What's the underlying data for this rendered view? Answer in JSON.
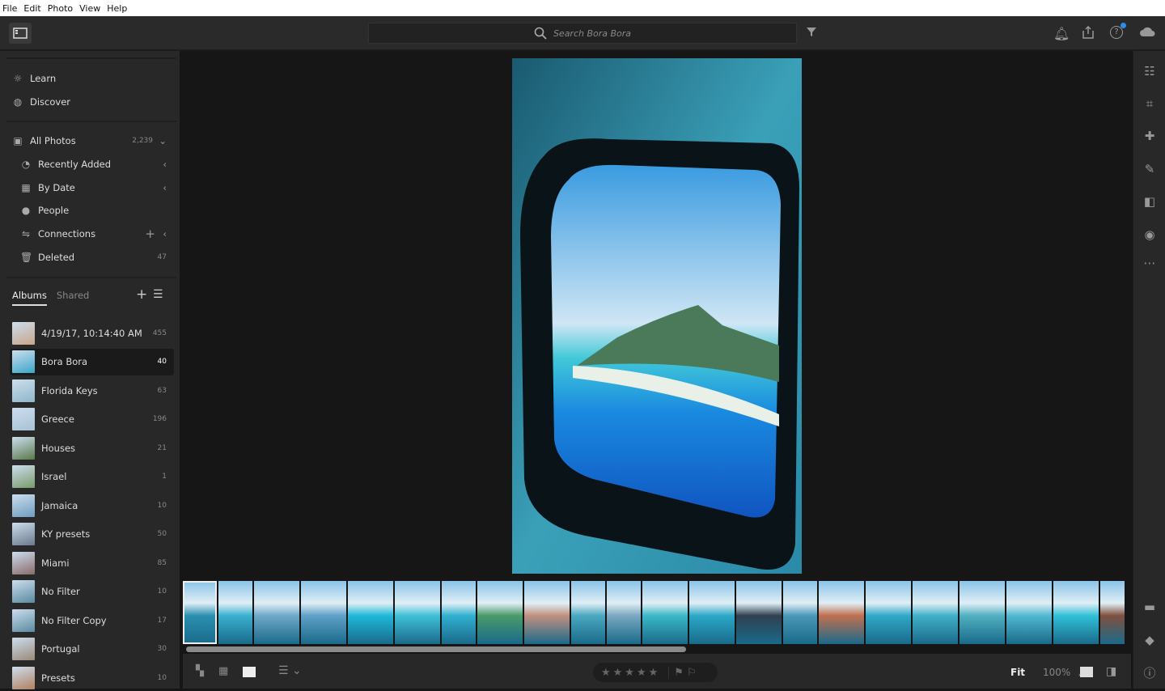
{
  "menu": [
    "File",
    "Edit",
    "Photo",
    "View",
    "Help"
  ],
  "search": {
    "placeholder": "Search Bora Bora"
  },
  "nav": {
    "learn": "Learn",
    "discover": "Discover",
    "all_photos": {
      "label": "All Photos",
      "count": "2,239"
    },
    "recently_added": "Recently Added",
    "by_date": "By Date",
    "people": "People",
    "connections": "Connections",
    "deleted": {
      "label": "Deleted",
      "count": "47"
    }
  },
  "album_tabs": {
    "albums": "Albums",
    "shared": "Shared"
  },
  "albums": [
    {
      "name": "4/19/17, 10:14:40 AM",
      "count": "455",
      "color": "#c9a58a"
    },
    {
      "name": "Bora Bora",
      "count": "40",
      "color": "#3aa6c9",
      "selected": true
    },
    {
      "name": "Florida Keys",
      "count": "63",
      "color": "#8fb7c9"
    },
    {
      "name": "Greece",
      "count": "196",
      "color": "#a8c2d6"
    },
    {
      "name": "Houses",
      "count": "21",
      "color": "#5a7a4a"
    },
    {
      "name": "Israel",
      "count": "1",
      "color": "#7a9a6a"
    },
    {
      "name": "Jamaica",
      "count": "10",
      "color": "#6d9cc0"
    },
    {
      "name": "KY presets",
      "count": "50",
      "color": "#6a7a8a"
    },
    {
      "name": "Miami",
      "count": "85",
      "color": "#8a6a6a"
    },
    {
      "name": "No Filter",
      "count": "10",
      "color": "#5a8aa0"
    },
    {
      "name": "No Filter Copy",
      "count": "17",
      "color": "#5a8aa0"
    },
    {
      "name": "Portugal",
      "count": "30",
      "color": "#9a8a7a"
    },
    {
      "name": "Presets",
      "count": "10",
      "color": "#b08060"
    }
  ],
  "filmstrip": [
    "#2a8fb0",
    "#3ab0d0",
    "#6fa8c8",
    "#5fa0c8",
    "#1fb8d8",
    "#40c0d8",
    "#30b0d0",
    "#4a9a6a",
    "#c09080",
    "#4aa8c0",
    "#7aa8c0",
    "#3ab8c8",
    "#2aa8c8",
    "#304050",
    "#4a98b8",
    "#c07050",
    "#30a8c8",
    "#40b0c8",
    "#50b0c0",
    "#50b8d0",
    "#30c0d8",
    "#805040"
  ],
  "bottom": {
    "zoom_fit": "Fit",
    "zoom_level": "100%",
    "stars": "★★★★★"
  }
}
